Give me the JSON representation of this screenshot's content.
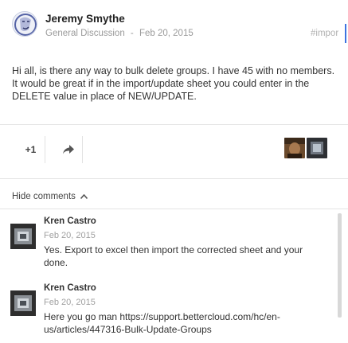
{
  "post": {
    "author": "Jeremy Smythe",
    "category": "General Discussion",
    "separator": "-",
    "date": "Feb 20, 2015",
    "tag": "#impor",
    "body": "Hi all, is there any way to bulk delete groups. I have 45 with no members. It would be great if in the import/update sheet you could enter in the DELETE value in place of NEW/UPDATE."
  },
  "actions": {
    "plus_one": "+1",
    "share_icon": "share-icon"
  },
  "comments_toggle": {
    "label": "Hide comments",
    "icon": "chevron-up-icon"
  },
  "comments": [
    {
      "author": "Kren Castro",
      "date": "Feb 20, 2015",
      "text": "Yes. Export to excel then import the corrected sheet and your done."
    },
    {
      "author": "Kren Castro",
      "date": "Feb 20, 2015",
      "text": "Here you go man https://support.bettercloud.com/hc/en-us/articles/447316-Bulk-Update-Groups"
    }
  ],
  "colors": {
    "accent": "#3d74e0",
    "divider": "#e5e5e5"
  }
}
